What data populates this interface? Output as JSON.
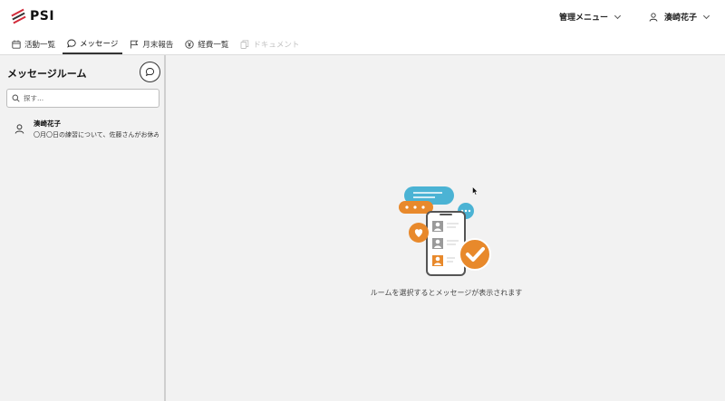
{
  "app": {
    "logo_text": "PSI"
  },
  "header": {
    "admin_menu_label": "管理メニュー",
    "user_name": "湊崎花子"
  },
  "tabs": [
    {
      "label": "活動一覧",
      "icon": "calendar-icon"
    },
    {
      "label": "メッセージ",
      "icon": "chat-icon",
      "active": true
    },
    {
      "label": "月末報告",
      "icon": "flag-icon"
    },
    {
      "label": "経費一覧",
      "icon": "yen-icon"
    },
    {
      "label": "ドキュメント",
      "icon": "document-icon",
      "disabled": true
    }
  ],
  "sidebar": {
    "title": "メッセージルーム",
    "search_placeholder": "探す...",
    "rooms": [
      {
        "name": "湊崎花子",
        "preview": "〇月〇日の練習について、佐藤さんがお休みです"
      }
    ]
  },
  "main": {
    "empty_message": "ルームを選択するとメッセージが表示されます"
  },
  "colors": {
    "accent": "#e8892b",
    "bubble_blue": "#4bb3d4",
    "logo_red": "#d22b3a"
  }
}
